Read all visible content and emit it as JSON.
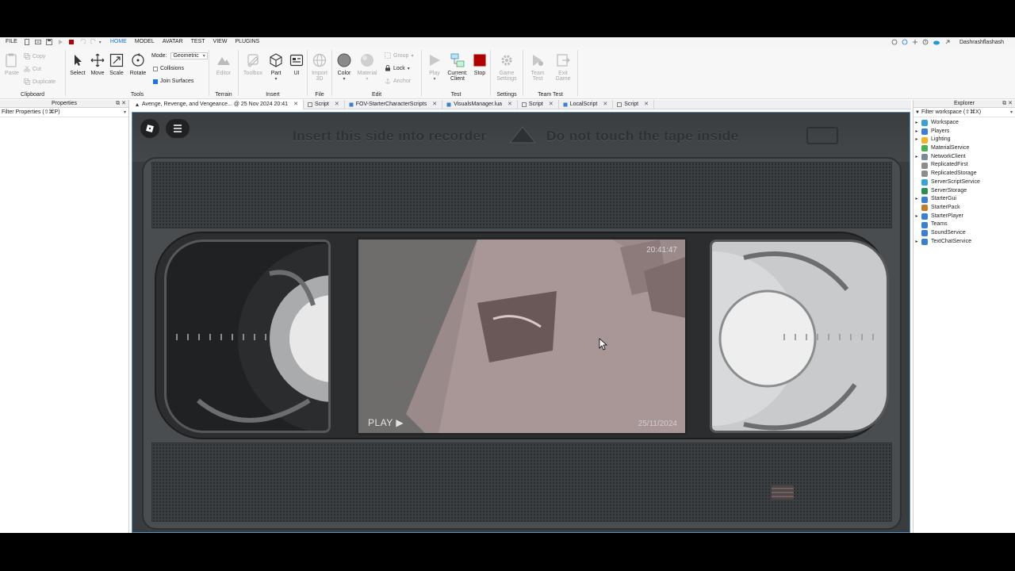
{
  "menubar": {
    "file": "FILE",
    "tabs": [
      "HOME",
      "MODEL",
      "AVATAR",
      "TEST",
      "VIEW",
      "PLUGINS"
    ],
    "active_tab": "HOME",
    "user": "Dashrashflashash"
  },
  "ribbon": {
    "clipboard": {
      "paste": "Paste",
      "copy": "Copy",
      "cut": "Cut",
      "duplicate": "Duplicate",
      "label": "Clipboard"
    },
    "tools": {
      "select": "Select",
      "move": "Move",
      "scale": "Scale",
      "rotate": "Rotate",
      "mode_label": "Mode:",
      "mode_value": "Geometric",
      "collisions": "Collisions",
      "join_surfaces": "Join Surfaces",
      "label": "Tools"
    },
    "terrain": {
      "editor": "Editor",
      "label": "Terrain"
    },
    "insert": {
      "toolbox": "Toolbox",
      "part": "Part",
      "ui": "UI",
      "label": "Insert"
    },
    "file": {
      "import3d_line1": "Import",
      "import3d_line2": "3D",
      "label": "File"
    },
    "edit": {
      "color": "Color",
      "material": "Material",
      "group": "Group",
      "lock": "Lock",
      "anchor": "Anchor",
      "label": "Edit"
    },
    "test": {
      "play": "Play",
      "current_line1": "Current:",
      "current_line2": "Client",
      "stop": "Stop",
      "label": "Test"
    },
    "settings": {
      "game_line1": "Game",
      "game_line2": "Settings",
      "label": "Settings"
    },
    "team_test": {
      "team_line1": "Team",
      "team_line2": "Test",
      "exit_line1": "Exit",
      "exit_line2": "Game",
      "label": "Team Test"
    }
  },
  "properties": {
    "title": "Properties",
    "filter": "Filter Properties (⇧⌘P)"
  },
  "tabs": [
    {
      "label": "Avenge, Revenge, and Vengeance... @ 25 Nov 2024 20:41"
    },
    {
      "label": "Script"
    },
    {
      "label": "FOV-StarterCharacterScripts"
    },
    {
      "label": "VisualsManager.lua"
    },
    {
      "label": "Script"
    },
    {
      "label": "LocalScript"
    },
    {
      "label": "Script"
    }
  ],
  "explorer": {
    "title": "Explorer",
    "filter": "Filter workspace (⇧⌘X)",
    "items": [
      {
        "label": "Workspace",
        "expandable": true,
        "color": "#3aa0d8"
      },
      {
        "label": "Players",
        "expandable": true,
        "color": "#3b7fd1"
      },
      {
        "label": "Lighting",
        "expandable": true,
        "color": "#f0b429"
      },
      {
        "label": "MaterialService",
        "expandable": false,
        "color": "#4caf50"
      },
      {
        "label": "NetworkClient",
        "expandable": true,
        "color": "#7a8a99"
      },
      {
        "label": "ReplicatedFirst",
        "expandable": false,
        "color": "#8c8c8c"
      },
      {
        "label": "ReplicatedStorage",
        "expandable": false,
        "color": "#8c8c8c"
      },
      {
        "label": "ServerScriptService",
        "expandable": false,
        "color": "#3aa0d8"
      },
      {
        "label": "ServerStorage",
        "expandable": false,
        "color": "#2e8b57"
      },
      {
        "label": "StarterGui",
        "expandable": true,
        "color": "#3b7fd1"
      },
      {
        "label": "StarterPack",
        "expandable": false,
        "color": "#c47c2b"
      },
      {
        "label": "StarterPlayer",
        "expandable": true,
        "color": "#3b7fd1"
      },
      {
        "label": "Teams",
        "expandable": false,
        "color": "#3b7fd1"
      },
      {
        "label": "SoundService",
        "expandable": false,
        "color": "#3b7fd1"
      },
      {
        "label": "TextChatService",
        "expandable": true,
        "color": "#3b7fd1"
      }
    ]
  },
  "viewport": {
    "emboss_left": "Insert this side into recorder",
    "emboss_right": "Do not touch the tape inside",
    "screen_time": "20:41:47",
    "screen_date": "25/11/2024",
    "screen_play": "PLAY ▶"
  },
  "colors": {
    "accent": "#1a73e8",
    "stop": "#b00000",
    "viewport_border": "#5b8fbf"
  }
}
